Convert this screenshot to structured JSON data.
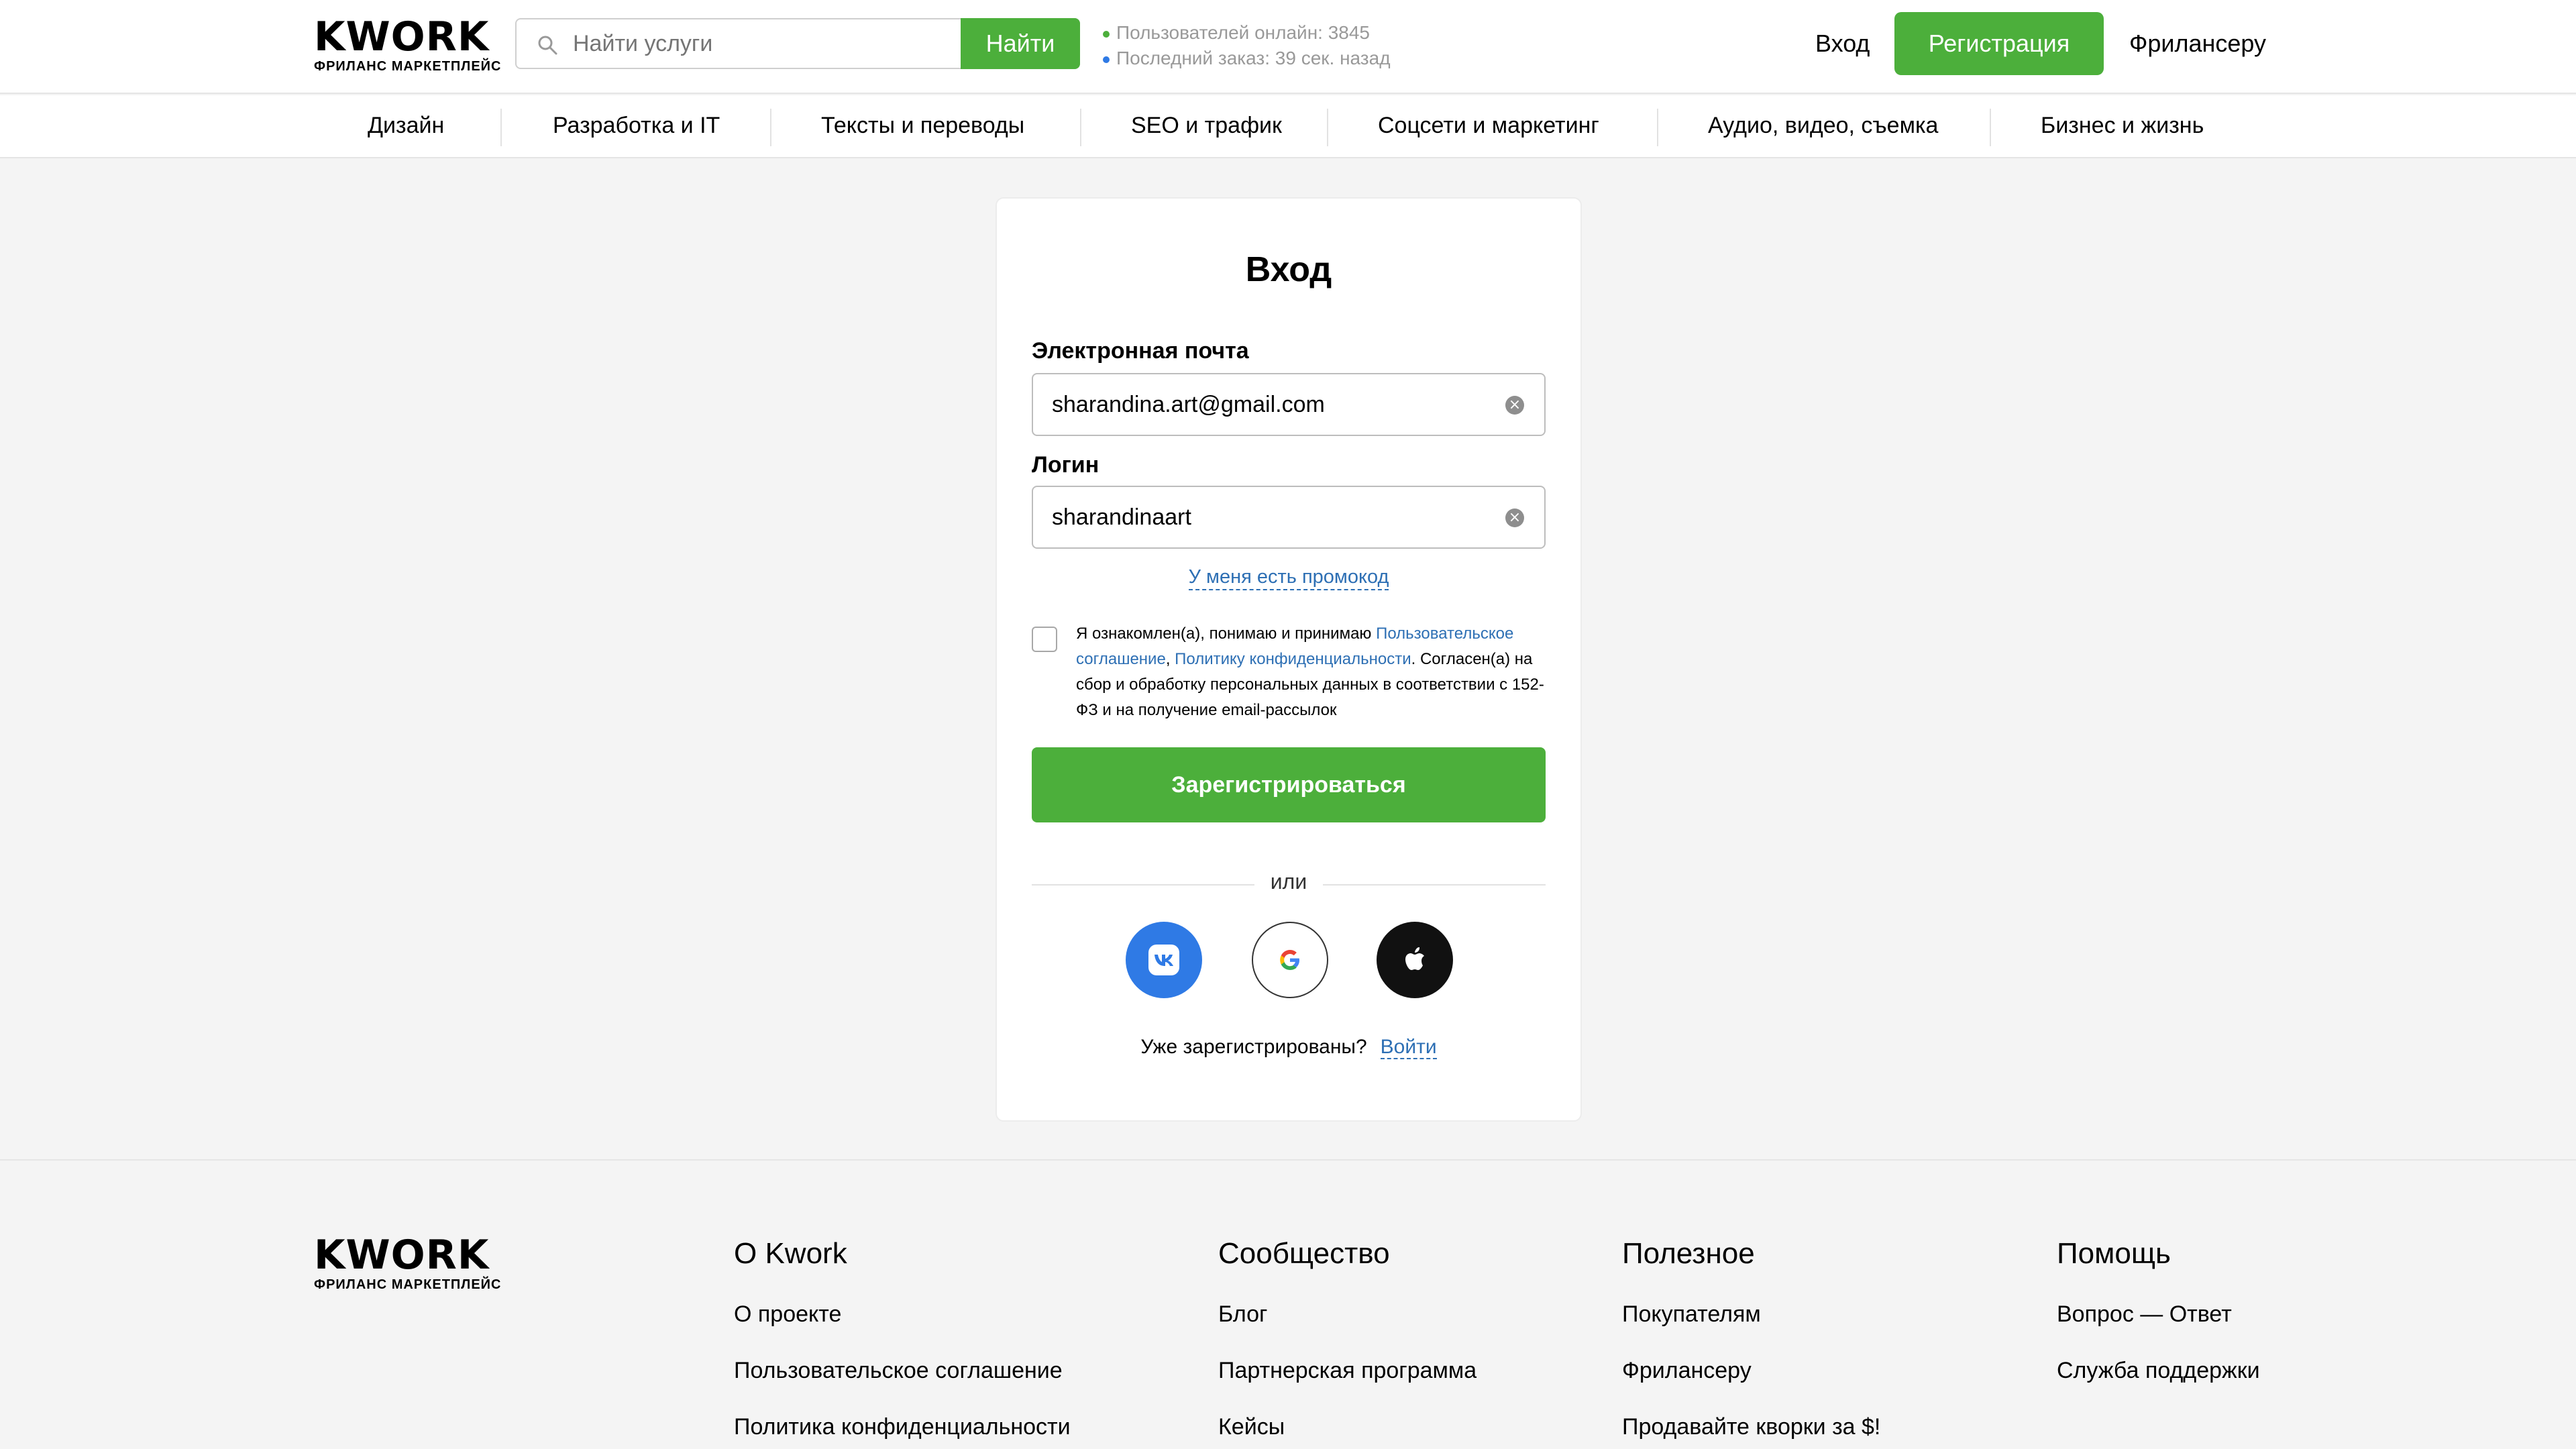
{
  "header": {
    "logo_text": "KWORK",
    "logo_subtitle": "ФРИЛАНС МАРКЕТПЛЕЙС",
    "search_placeholder": "Найти услуги",
    "search_button": "Найти",
    "stats": {
      "online": "Пользователей онлайн: 3845",
      "last_order": "Последний заказ: 39 сек. назад",
      "online_dot_color": "#4caf3b",
      "order_dot_color": "#2f7ae5"
    },
    "login_link": "Вход",
    "register_button": "Регистрация",
    "freelancer_link": "Фрилансеру"
  },
  "categories": [
    "Дизайн",
    "Разработка и IT",
    "Тексты и переводы",
    "SEO и трафик",
    "Соцсети и маркетинг",
    "Аудио, видео, съемка",
    "Бизнес и жизнь"
  ],
  "form": {
    "title": "Вход",
    "email_label": "Электронная почта",
    "email_value": "sharandina.art@gmail.com",
    "login_label": "Логин",
    "login_value": "sharandinaart",
    "promo_link": "У меня есть промокод",
    "terms": {
      "part1": "Я ознакомлен(а), понимаю и принимаю ",
      "link1": "Пользовательское соглашение",
      "sep": ", ",
      "link2": "Политику конфиденциальности",
      "part2": ". Согласен(а) на сбор и обработку персональных данных в соответствии с 152-ФЗ и на получение email-рассылок"
    },
    "submit_button": "Зарегистрироваться",
    "or_text": "или",
    "social": [
      "vk-icon",
      "google-icon",
      "apple-icon"
    ],
    "already_text": "Уже зарегистрированы?",
    "already_link": "Войти"
  },
  "footer": {
    "logo_text": "KWORK",
    "logo_subtitle": "ФРИЛАНС МАРКЕТПЛЕЙС",
    "columns": [
      {
        "title": "О Kwork",
        "links": [
          "О проекте",
          "Пользовательское соглашение",
          "Политика конфиденциальности"
        ]
      },
      {
        "title": "Сообщество",
        "links": [
          "Блог",
          "Партнерская программа",
          "Кейсы"
        ]
      },
      {
        "title": "Полезное",
        "links": [
          "Покупателям",
          "Фрилансеру",
          "Продавайте кворки за $!"
        ]
      },
      {
        "title": "Помощь",
        "links": [
          "Вопрос — Ответ",
          "Служба поддержки"
        ]
      }
    ]
  },
  "colors": {
    "accent_green": "#4caf3b",
    "link_blue": "#2d6fb4",
    "logo_orange": "#ffa800"
  }
}
